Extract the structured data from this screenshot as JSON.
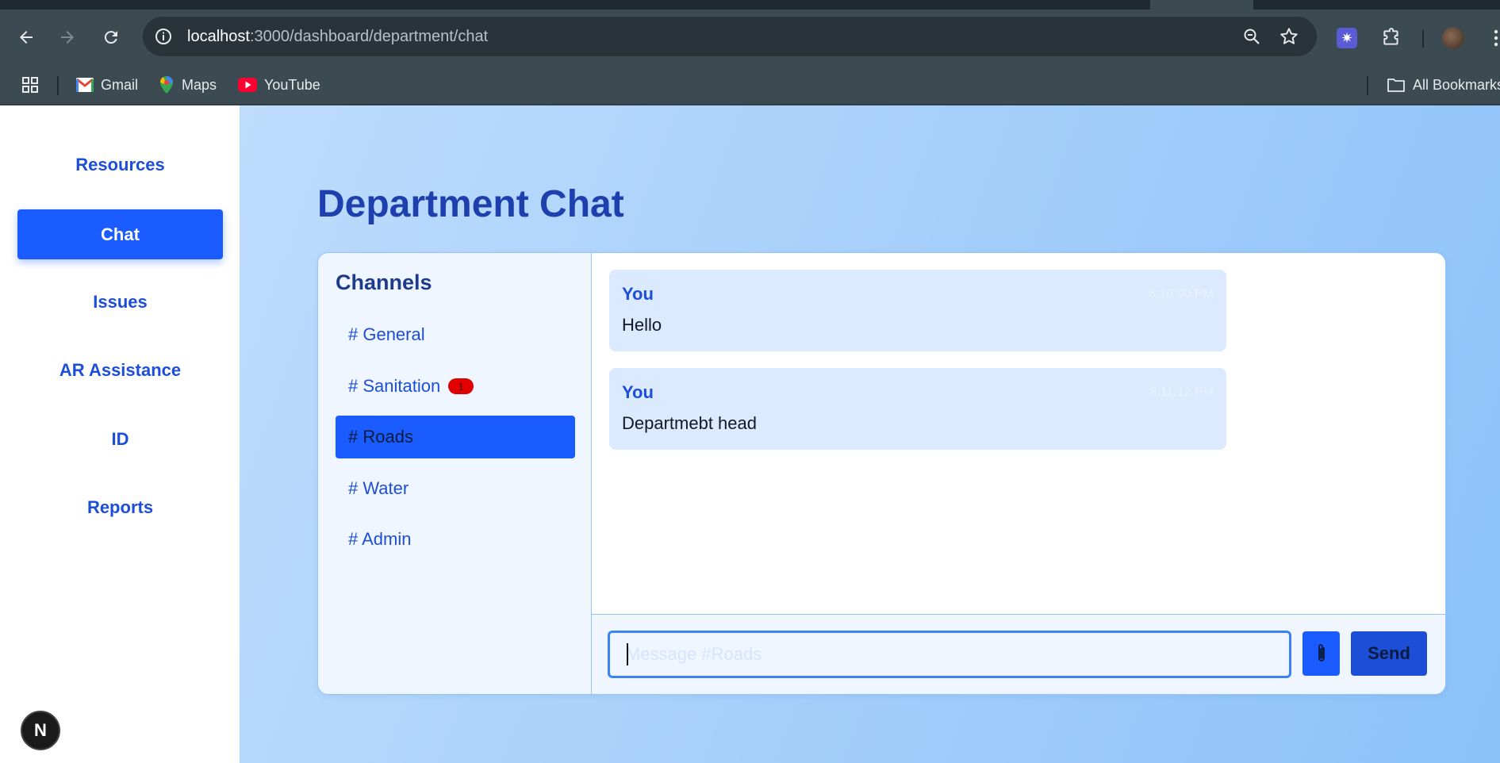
{
  "browser": {
    "url_host": "localhost",
    "url_path": ":3000/dashboard/department/chat",
    "bookmarks": [
      {
        "label": "Gmail",
        "icon": "gmail-icon"
      },
      {
        "label": "Maps",
        "icon": "maps-icon"
      },
      {
        "label": "YouTube",
        "icon": "youtube-icon"
      }
    ],
    "all_bookmarks_label": "All Bookmarks"
  },
  "sidebar": {
    "items": [
      {
        "label": "Resources",
        "active": false
      },
      {
        "label": "Chat",
        "active": true
      },
      {
        "label": "Issues",
        "active": false
      },
      {
        "label": "AR Assistance",
        "active": false
      },
      {
        "label": "ID",
        "active": false
      },
      {
        "label": "Reports",
        "active": false
      }
    ],
    "badge_letter": "N"
  },
  "page": {
    "title": "Department Chat"
  },
  "channels": {
    "title": "Channels",
    "items": [
      {
        "label": "# General",
        "active": false,
        "unread": null
      },
      {
        "label": "# Sanitation",
        "active": false,
        "unread": "1"
      },
      {
        "label": "# Roads",
        "active": true,
        "unread": null
      },
      {
        "label": "# Water",
        "active": false,
        "unread": null
      },
      {
        "label": "# Admin",
        "active": false,
        "unread": null
      }
    ]
  },
  "messages": [
    {
      "author": "You",
      "time": "8:10:00 PM",
      "body": "Hello"
    },
    {
      "author": "You",
      "time": "8:11:12 PM",
      "body": "Departmebt head"
    }
  ],
  "composer": {
    "placeholder": "Message #Roads",
    "send_label": "Send"
  },
  "colors": {
    "primary": "#1a5cff",
    "heading": "#1e40af",
    "badge": "#e00000"
  }
}
